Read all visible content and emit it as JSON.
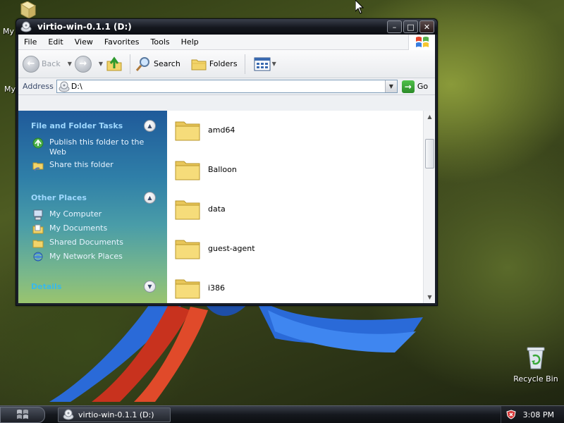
{
  "desktop": {
    "top_label_1": "My",
    "top_label_2": "My",
    "recycle_bin": "Recycle Bin"
  },
  "window": {
    "title": "virtio-win-0.1.1 (D:)",
    "buttons": {
      "minimize": "–",
      "maximize": "□",
      "close": "✕"
    }
  },
  "menu": [
    "File",
    "Edit",
    "View",
    "Favorites",
    "Tools",
    "Help"
  ],
  "toolbar": {
    "back": "Back",
    "search": "Search",
    "folders": "Folders"
  },
  "address": {
    "label": "Address",
    "value": "D:\\",
    "go": "Go"
  },
  "taskpane": {
    "file_tasks": {
      "title": "File and Folder Tasks",
      "items": [
        "Publish this folder to the Web",
        "Share this folder"
      ]
    },
    "other_places": {
      "title": "Other Places",
      "items": [
        "My Computer",
        "My Documents",
        "Shared Documents",
        "My Network Places"
      ]
    },
    "details": {
      "title": "Details"
    }
  },
  "files": [
    "amd64",
    "Balloon",
    "data",
    "guest-agent",
    "i386"
  ],
  "taskbar": {
    "task_title": "virtio-win-0.1.1 (D:)",
    "clock": "3:08 PM"
  },
  "colors": {
    "taskpane_title": "#9fd8ff",
    "folder": "#f2d46a"
  }
}
